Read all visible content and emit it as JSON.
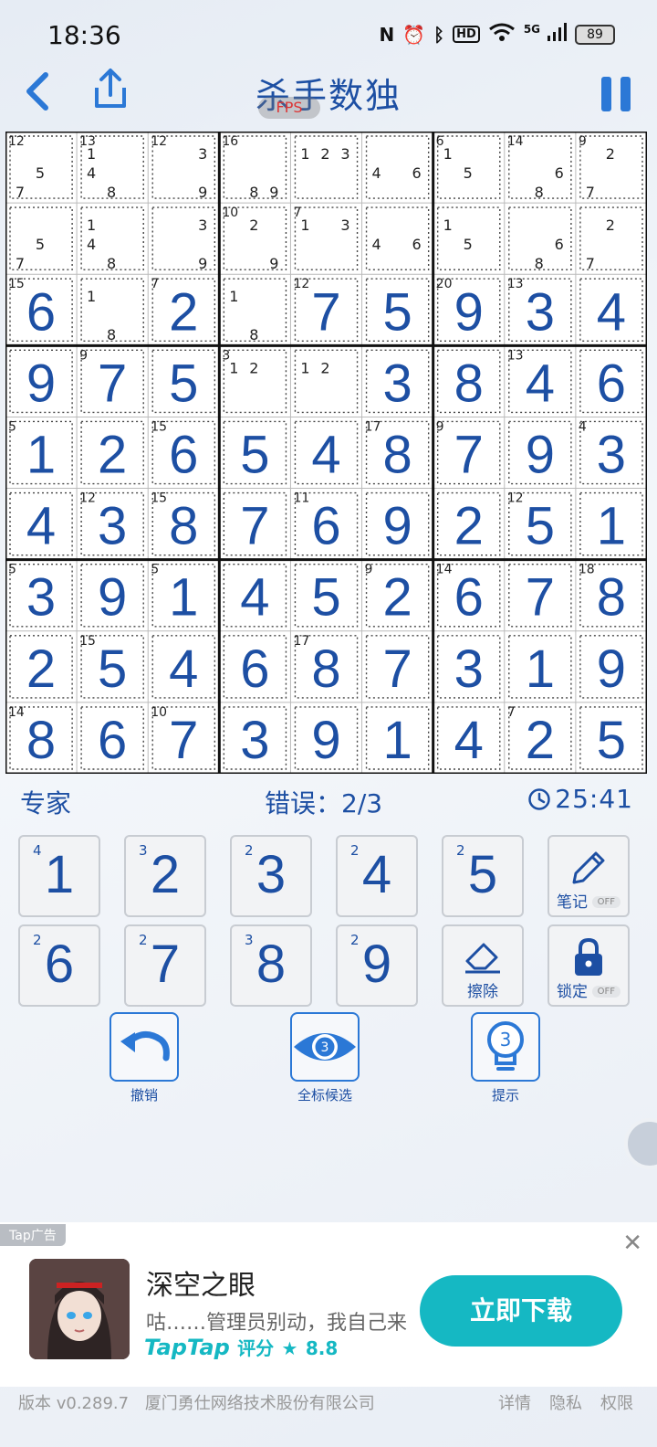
{
  "status_bar": {
    "time": "18:36",
    "battery": "89",
    "signal_text": "5G"
  },
  "header": {
    "title": "杀手数独",
    "fps_badge": "FPS"
  },
  "colors": {
    "accent": "#1d4fa3",
    "button_blue": "#2b78d6",
    "ad_teal": "#15b8c3"
  },
  "board": {
    "grid": [
      [
        0,
        0,
        0,
        0,
        0,
        0,
        0,
        0,
        0
      ],
      [
        0,
        0,
        0,
        0,
        0,
        0,
        0,
        0,
        0
      ],
      [
        6,
        0,
        2,
        0,
        7,
        5,
        9,
        3,
        4
      ],
      [
        9,
        7,
        5,
        0,
        0,
        3,
        8,
        4,
        6
      ],
      [
        1,
        2,
        6,
        5,
        4,
        8,
        7,
        9,
        3
      ],
      [
        4,
        3,
        8,
        7,
        6,
        9,
        2,
        5,
        1
      ],
      [
        3,
        9,
        1,
        4,
        5,
        2,
        6,
        7,
        8
      ],
      [
        2,
        5,
        4,
        6,
        8,
        7,
        3,
        1,
        9
      ],
      [
        8,
        6,
        7,
        3,
        9,
        1,
        4,
        2,
        5
      ]
    ],
    "notes": [
      [
        [
          5,
          7
        ],
        [
          1,
          4,
          8
        ],
        [
          3,
          9
        ],
        [
          8,
          9
        ],
        [
          1,
          2,
          3
        ],
        [
          4,
          6
        ],
        [
          1,
          5
        ],
        [
          6,
          8
        ],
        [
          2,
          7
        ]
      ],
      [
        [
          5,
          7
        ],
        [
          1,
          4,
          8
        ],
        [
          3,
          9
        ],
        [
          2,
          9
        ],
        [
          1,
          3
        ],
        [
          4,
          6
        ],
        [
          1,
          5
        ],
        [
          6,
          8
        ],
        [
          2,
          7
        ]
      ],
      [
        [],
        [
          1,
          8
        ],
        [],
        [
          1,
          8
        ],
        [],
        [],
        [],
        [],
        []
      ],
      [
        [],
        [],
        [],
        [
          1,
          2
        ],
        [
          1,
          2
        ],
        [],
        [],
        [],
        []
      ],
      [
        [],
        [],
        [],
        [],
        [],
        [],
        [],
        [],
        []
      ],
      [
        [],
        [],
        [],
        [],
        [],
        [],
        [],
        [],
        []
      ],
      [
        [],
        [],
        [],
        [],
        [],
        [],
        [],
        [],
        []
      ],
      [
        [],
        [],
        [],
        [],
        [],
        [],
        [],
        [],
        []
      ],
      [
        [],
        [],
        [],
        [],
        [],
        [],
        [],
        [],
        []
      ]
    ],
    "cage_sums": [
      {
        "r": 0,
        "c": 0,
        "sum": "12"
      },
      {
        "r": 0,
        "c": 1,
        "sum": "13"
      },
      {
        "r": 0,
        "c": 2,
        "sum": "12"
      },
      {
        "r": 0,
        "c": 3,
        "sum": "16"
      },
      {
        "r": 0,
        "c": 6,
        "sum": "6"
      },
      {
        "r": 0,
        "c": 7,
        "sum": "14"
      },
      {
        "r": 0,
        "c": 8,
        "sum": "9"
      },
      {
        "r": 1,
        "c": 3,
        "sum": "10"
      },
      {
        "r": 1,
        "c": 4,
        "sum": "7"
      },
      {
        "r": 2,
        "c": 0,
        "sum": "15"
      },
      {
        "r": 2,
        "c": 2,
        "sum": "7"
      },
      {
        "r": 2,
        "c": 4,
        "sum": "12"
      },
      {
        "r": 2,
        "c": 6,
        "sum": "20"
      },
      {
        "r": 2,
        "c": 7,
        "sum": "13"
      },
      {
        "r": 3,
        "c": 1,
        "sum": "9"
      },
      {
        "r": 3,
        "c": 3,
        "sum": "3"
      },
      {
        "r": 3,
        "c": 7,
        "sum": "13"
      },
      {
        "r": 4,
        "c": 0,
        "sum": "5"
      },
      {
        "r": 4,
        "c": 2,
        "sum": "15"
      },
      {
        "r": 4,
        "c": 5,
        "sum": "17"
      },
      {
        "r": 4,
        "c": 6,
        "sum": "9"
      },
      {
        "r": 4,
        "c": 8,
        "sum": "4"
      },
      {
        "r": 5,
        "c": 1,
        "sum": "12"
      },
      {
        "r": 5,
        "c": 2,
        "sum": "15"
      },
      {
        "r": 5,
        "c": 4,
        "sum": "11"
      },
      {
        "r": 5,
        "c": 7,
        "sum": "12"
      },
      {
        "r": 6,
        "c": 0,
        "sum": "5"
      },
      {
        "r": 6,
        "c": 2,
        "sum": "5"
      },
      {
        "r": 6,
        "c": 5,
        "sum": "9"
      },
      {
        "r": 6,
        "c": 6,
        "sum": "14"
      },
      {
        "r": 6,
        "c": 8,
        "sum": "18"
      },
      {
        "r": 7,
        "c": 1,
        "sum": "15"
      },
      {
        "r": 7,
        "c": 4,
        "sum": "17"
      },
      {
        "r": 8,
        "c": 0,
        "sum": "14"
      },
      {
        "r": 8,
        "c": 2,
        "sum": "10"
      },
      {
        "r": 8,
        "c": 7,
        "sum": "7"
      }
    ]
  },
  "game_status": {
    "level": "专家",
    "errors": "错误：2/3",
    "timer": "25:41"
  },
  "keypad": {
    "numbers": [
      {
        "digit": "1",
        "remaining": "4"
      },
      {
        "digit": "2",
        "remaining": "3"
      },
      {
        "digit": "3",
        "remaining": "2"
      },
      {
        "digit": "4",
        "remaining": "2"
      },
      {
        "digit": "5",
        "remaining": "2"
      },
      {
        "digit": "6",
        "remaining": "2"
      },
      {
        "digit": "7",
        "remaining": "2"
      },
      {
        "digit": "8",
        "remaining": "3"
      },
      {
        "digit": "9",
        "remaining": "2"
      }
    ],
    "notes_label": "笔记",
    "notes_state": "OFF",
    "erase_label": "擦除",
    "lock_label": "锁定",
    "lock_state": "OFF"
  },
  "actions": {
    "undo_label": "撤销",
    "fill_candidates_label": "全标候选",
    "fill_candidates_count": "3",
    "hint_label": "提示",
    "hint_count": "3"
  },
  "ad": {
    "tag": "Tap广告",
    "app_name": "深空之眼",
    "tagline": "咕……管理员别动，我自己来",
    "rating_brand": "TapTap",
    "rating_label": "评分",
    "rating_value": "8.8",
    "download_label": "立即下载"
  },
  "footer": {
    "version": "版本 v0.289.7",
    "company": "厦门勇仕网络技术股份有限公司",
    "links": [
      "详情",
      "隐私",
      "权限"
    ]
  }
}
